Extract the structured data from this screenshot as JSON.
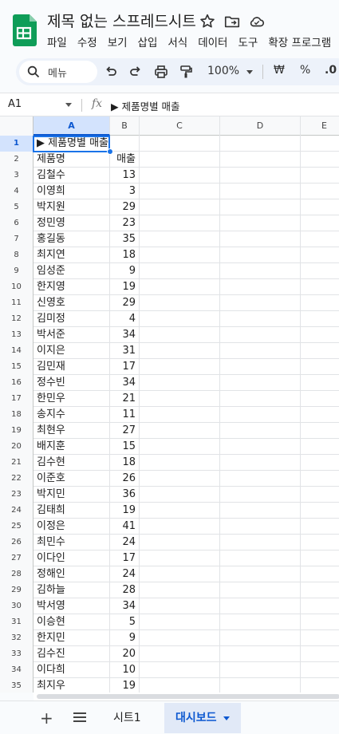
{
  "app": {
    "doc_title": "제목 없는 스프레드시트",
    "menu": [
      "파일",
      "수정",
      "보기",
      "삽입",
      "서식",
      "데이터",
      "도구",
      "확장 프로그램"
    ]
  },
  "toolbar": {
    "search_label": "메뉴",
    "zoom": "100%",
    "currency": "₩",
    "percent": "%",
    "decimal": ".0"
  },
  "formula_bar": {
    "cell_ref": "A1",
    "fx": "fx",
    "content": "▶ 제품명별 매출"
  },
  "columns": [
    "A",
    "B",
    "C",
    "D",
    "E"
  ],
  "rows": [
    {
      "n": "1",
      "a": "▶ 제품명별 매출",
      "b": ""
    },
    {
      "n": "2",
      "a": "제품명",
      "b": "매출"
    },
    {
      "n": "3",
      "a": "김철수",
      "b": "13"
    },
    {
      "n": "4",
      "a": "이영희",
      "b": "3"
    },
    {
      "n": "5",
      "a": "박지원",
      "b": "29"
    },
    {
      "n": "6",
      "a": "정민영",
      "b": "23"
    },
    {
      "n": "7",
      "a": "홍길동",
      "b": "35"
    },
    {
      "n": "8",
      "a": "최지연",
      "b": "18"
    },
    {
      "n": "9",
      "a": "임성준",
      "b": "9"
    },
    {
      "n": "10",
      "a": "한지영",
      "b": "19"
    },
    {
      "n": "11",
      "a": "신영호",
      "b": "29"
    },
    {
      "n": "12",
      "a": "김미정",
      "b": "4"
    },
    {
      "n": "13",
      "a": "박서준",
      "b": "34"
    },
    {
      "n": "14",
      "a": "이지은",
      "b": "31"
    },
    {
      "n": "15",
      "a": "김민재",
      "b": "17"
    },
    {
      "n": "16",
      "a": "정수빈",
      "b": "34"
    },
    {
      "n": "17",
      "a": "한민우",
      "b": "21"
    },
    {
      "n": "18",
      "a": "송지수",
      "b": "11"
    },
    {
      "n": "19",
      "a": "최현우",
      "b": "27"
    },
    {
      "n": "20",
      "a": "배지훈",
      "b": "15"
    },
    {
      "n": "21",
      "a": "김수현",
      "b": "18"
    },
    {
      "n": "22",
      "a": "이준호",
      "b": "26"
    },
    {
      "n": "23",
      "a": "박지민",
      "b": "36"
    },
    {
      "n": "24",
      "a": "김태희",
      "b": "19"
    },
    {
      "n": "25",
      "a": "이정은",
      "b": "41"
    },
    {
      "n": "26",
      "a": "최민수",
      "b": "24"
    },
    {
      "n": "27",
      "a": "이다인",
      "b": "17"
    },
    {
      "n": "28",
      "a": "정해인",
      "b": "24"
    },
    {
      "n": "29",
      "a": "김하늘",
      "b": "28"
    },
    {
      "n": "30",
      "a": "박서영",
      "b": "34"
    },
    {
      "n": "31",
      "a": "이승현",
      "b": "5"
    },
    {
      "n": "32",
      "a": "한지민",
      "b": "9"
    },
    {
      "n": "33",
      "a": "김수진",
      "b": "20"
    },
    {
      "n": "34",
      "a": "이다희",
      "b": "10"
    },
    {
      "n": "35",
      "a": "최지우",
      "b": "19"
    }
  ],
  "sheet_tabs": [
    "시트1",
    "대시보드"
  ],
  "colors": {
    "accent": "#0b57d0",
    "selection": "#1a73e8",
    "sheets_green": "#0f9d58"
  }
}
